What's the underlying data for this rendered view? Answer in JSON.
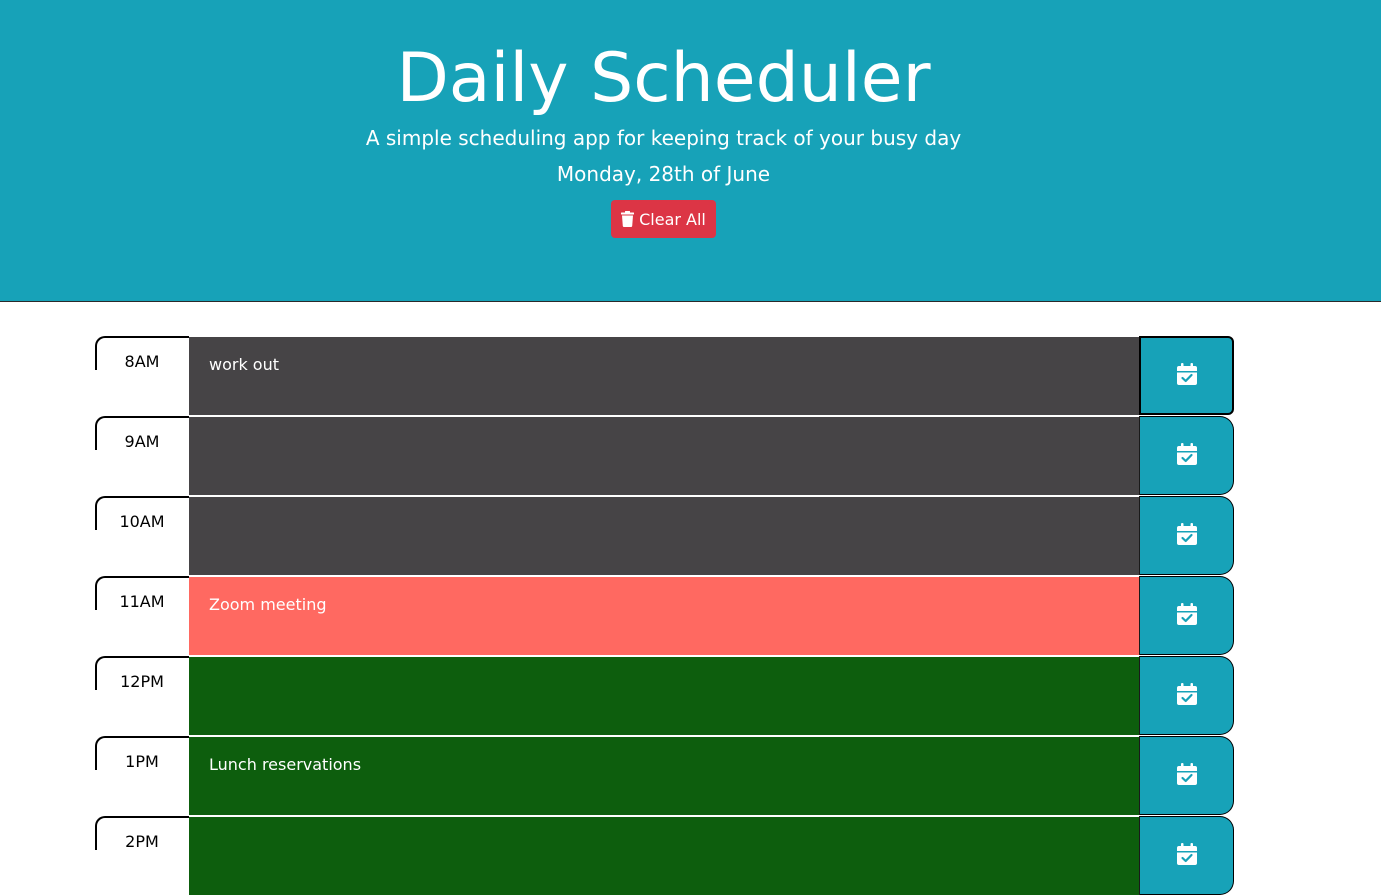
{
  "header": {
    "title": "Daily Scheduler",
    "subtitle": "A simple scheduling app for keeping track of your busy day",
    "date": "Monday, 28th of June",
    "clear_label": "Clear All",
    "clear_icon": "trash-icon"
  },
  "colors": {
    "header_bg": "#17a2b8",
    "past": "#464446",
    "present": "#ff6961",
    "future": "#0d5e0d",
    "clear_button": "#dc3545",
    "save_button": "#17a2b8"
  },
  "save_icon": "calendar-check-icon",
  "hours": [
    {
      "label": "8AM",
      "text": "work out",
      "state": "past"
    },
    {
      "label": "9AM",
      "text": "",
      "state": "past"
    },
    {
      "label": "10AM",
      "text": "",
      "state": "past"
    },
    {
      "label": "11AM",
      "text": "Zoom meeting",
      "state": "present"
    },
    {
      "label": "12PM",
      "text": "",
      "state": "future"
    },
    {
      "label": "1PM",
      "text": "Lunch reservations",
      "state": "future"
    },
    {
      "label": "2PM",
      "text": "",
      "state": "future"
    }
  ]
}
